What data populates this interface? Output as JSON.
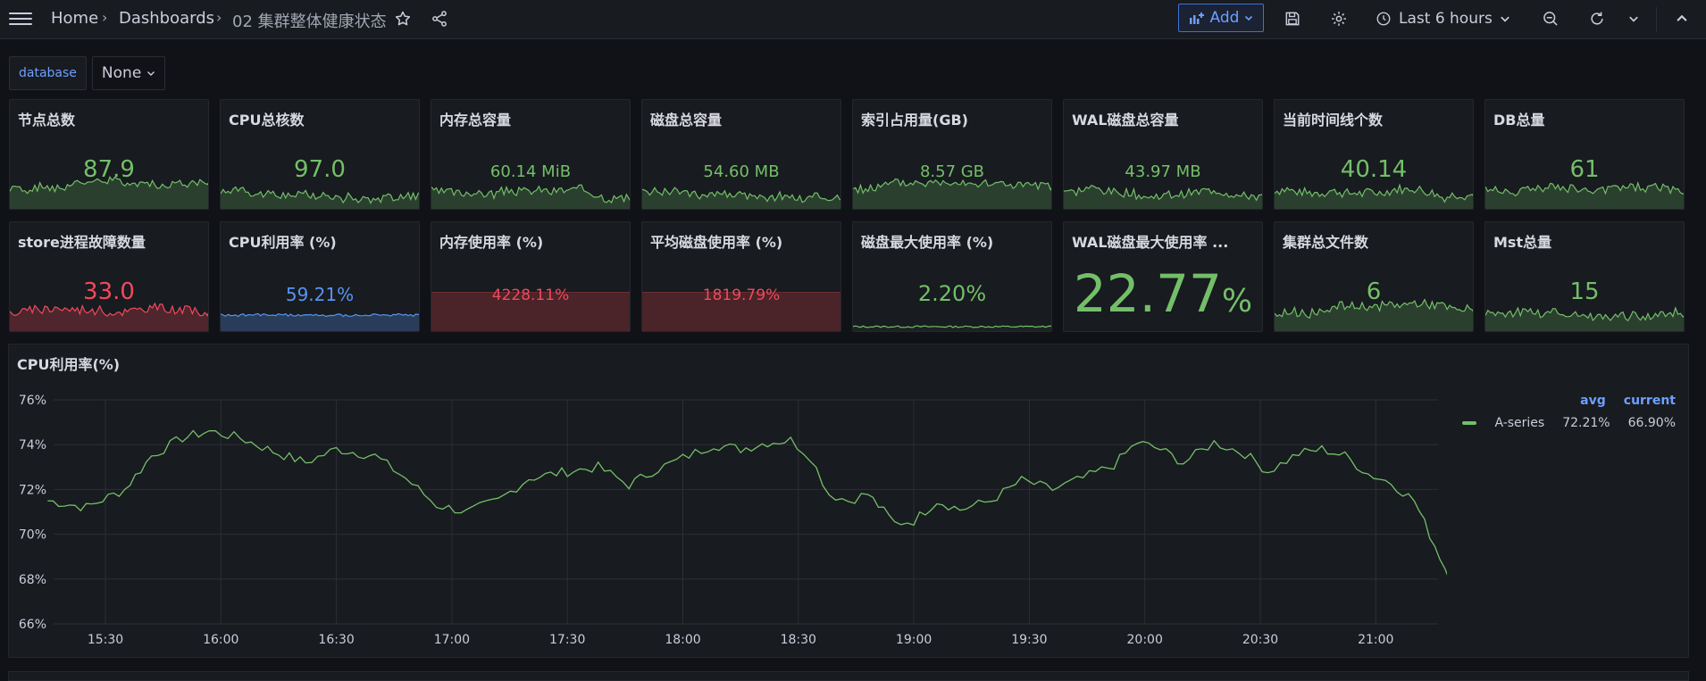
{
  "breadcrumb": {
    "home": "Home",
    "dashboards": "Dashboards",
    "current": "02 集群整体健康状态"
  },
  "toolbar": {
    "add_label": "Add",
    "time_range": "Last 6 hours"
  },
  "variables": {
    "database_label": "database",
    "database_value": "None"
  },
  "stats": [
    {
      "title": "节点总数",
      "value": "87.9",
      "color": "#73bf69",
      "style": "spark",
      "seed": 1
    },
    {
      "title": "CPU总核数",
      "value": "97.0",
      "color": "#73bf69",
      "style": "spark",
      "seed": 2
    },
    {
      "title": "内存总容量",
      "value": "60.14 MiB",
      "color": "#73bf69",
      "style": "spark",
      "seed": 3
    },
    {
      "title": "磁盘总容量",
      "value": "54.60 MB",
      "color": "#73bf69",
      "style": "spark",
      "seed": 4
    },
    {
      "title": "索引占用量(GB)",
      "value": "8.57 GB",
      "color": "#73bf69",
      "style": "spark",
      "seed": 5
    },
    {
      "title": "WAL磁盘总容量",
      "value": "43.97 MB",
      "color": "#73bf69",
      "style": "spark",
      "seed": 6
    },
    {
      "title": "当前时间线个数",
      "value": "40.14",
      "color": "#73bf69",
      "style": "spark",
      "seed": 7
    },
    {
      "title": "DB总量",
      "value": "61",
      "color": "#73bf69",
      "style": "spark",
      "seed": 8
    },
    {
      "title": "store进程故障数量",
      "value": "33.0",
      "color": "#f2495c",
      "style": "spark",
      "seed": 9
    },
    {
      "title": "CPU利用率 (%)",
      "value": "59.21%",
      "color": "#5794f2",
      "style": "flat",
      "seed": 10
    },
    {
      "title": "内存使用率 (%)",
      "value": "4228.11%",
      "color": "#f2495c",
      "style": "redbar",
      "seed": 11
    },
    {
      "title": "平均磁盘使用率 (%)",
      "value": "1819.79%",
      "color": "#f2495c",
      "style": "redbar",
      "seed": 12
    },
    {
      "title": "磁盘最大使用率 (%)",
      "value": "2.20%",
      "color": "#73bf69",
      "style": "line",
      "seed": 13
    },
    {
      "title": "WAL磁盘最大使用率 ...",
      "value": "22.77%",
      "color": "#73bf69",
      "style": "huge",
      "seed": 14
    },
    {
      "title": "集群总文件数",
      "value": "6",
      "color": "#73bf69",
      "style": "spark",
      "seed": 15
    },
    {
      "title": "Mst总量",
      "value": "15",
      "color": "#73bf69",
      "style": "spark",
      "seed": 16
    }
  ],
  "main_chart": {
    "title": "CPU利用率(%)",
    "legend": {
      "headers": [
        "avg",
        "current"
      ],
      "series_name": "A-series",
      "avg": "72.21%",
      "current": "66.90%"
    }
  },
  "chart_data": {
    "type": "line",
    "ylim": [
      66,
      76
    ],
    "yticks": [
      "76%",
      "74%",
      "72%",
      "70%",
      "68%",
      "66%"
    ],
    "xticks": [
      "15:30",
      "16:00",
      "16:30",
      "17:00",
      "17:30",
      "18:00",
      "18:30",
      "19:00",
      "19:30",
      "20:00",
      "20:30",
      "21:00"
    ],
    "xrange_minutes": [
      915,
      1283
    ],
    "grid": true,
    "legend_position": "right",
    "series": [
      {
        "name": "A-series",
        "color": "#73bf69",
        "points": [
          [
            915,
            71.5
          ],
          [
            925,
            71.2
          ],
          [
            935,
            72.0
          ],
          [
            942,
            73.5
          ],
          [
            950,
            74.3
          ],
          [
            957,
            74.6
          ],
          [
            965,
            74.3
          ],
          [
            975,
            73.6
          ],
          [
            982,
            73.2
          ],
          [
            990,
            73.8
          ],
          [
            1000,
            73.5
          ],
          [
            1008,
            72.5
          ],
          [
            1016,
            71.3
          ],
          [
            1024,
            71.0
          ],
          [
            1032,
            71.5
          ],
          [
            1040,
            72.5
          ],
          [
            1050,
            72.8
          ],
          [
            1058,
            73.0
          ],
          [
            1066,
            72.2
          ],
          [
            1072,
            72.8
          ],
          [
            1080,
            73.4
          ],
          [
            1088,
            74.0
          ],
          [
            1095,
            73.8
          ],
          [
            1102,
            74.1
          ],
          [
            1108,
            74.2
          ],
          [
            1113,
            73.5
          ],
          [
            1118,
            71.8
          ],
          [
            1123,
            71.5
          ],
          [
            1128,
            71.8
          ],
          [
            1135,
            70.5
          ],
          [
            1140,
            70.6
          ],
          [
            1146,
            71.5
          ],
          [
            1152,
            71.1
          ],
          [
            1160,
            71.5
          ],
          [
            1168,
            72.4
          ],
          [
            1176,
            72.0
          ],
          [
            1184,
            72.5
          ],
          [
            1192,
            73.1
          ],
          [
            1198,
            74.1
          ],
          [
            1204,
            73.8
          ],
          [
            1210,
            73.2
          ],
          [
            1218,
            74.1
          ],
          [
            1226,
            73.6
          ],
          [
            1232,
            72.8
          ],
          [
            1240,
            73.6
          ],
          [
            1246,
            73.8
          ],
          [
            1252,
            73.5
          ],
          [
            1258,
            72.7
          ],
          [
            1264,
            72.3
          ],
          [
            1270,
            71.5
          ],
          [
            1274,
            70.0
          ],
          [
            1278,
            68.5
          ],
          [
            1281,
            67.5
          ],
          [
            1283,
            66.9
          ]
        ]
      }
    ]
  }
}
